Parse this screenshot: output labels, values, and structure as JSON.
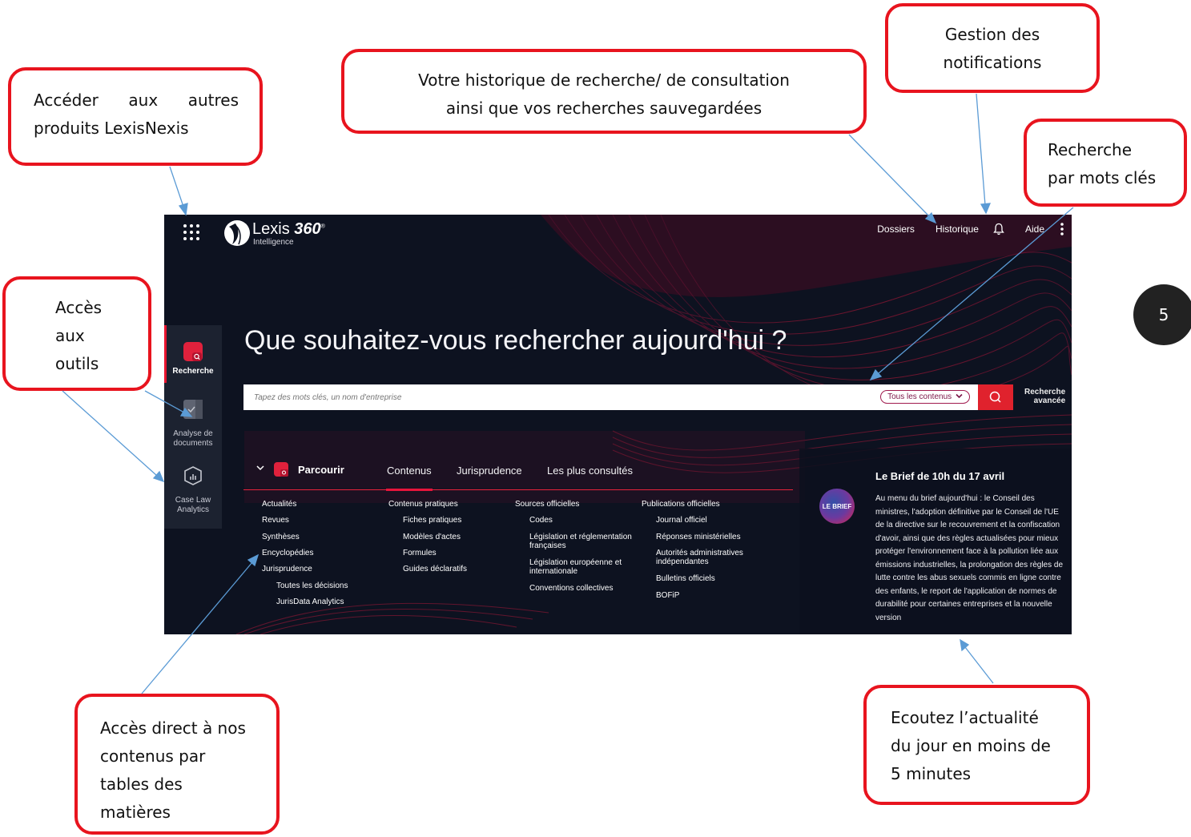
{
  "page_number": "5",
  "callouts": {
    "products": {
      "line1": "Accéder aux autres",
      "line2": "produits LexisNexis"
    },
    "history": {
      "line1": "Votre historique de recherche/ de consultation",
      "line2": "ainsi que vos recherches sauvegardées"
    },
    "notifications": {
      "line1": "Gestion des",
      "line2": "notifications"
    },
    "keyword": {
      "line1": "Recherche",
      "line2": "par mots clés"
    },
    "tools": {
      "line1": "Accès",
      "line2": "aux",
      "line3": "outils"
    },
    "toc": {
      "line1": "Accès direct à nos",
      "line2": "contenus par",
      "line3": "tables des",
      "line4": "matières"
    },
    "brief": {
      "line1": "Ecoutez l’actualité",
      "line2": "du jour en moins de",
      "line3": "5 minutes"
    }
  },
  "app": {
    "brand_name": "Lexis",
    "brand_version": "360",
    "brand_trademark": "®",
    "brand_sub": "Intelligence",
    "topnav": {
      "dossiers": "Dossiers",
      "historique": "Historique",
      "aide": "Aide"
    },
    "sidebar": {
      "recherche": "Recherche",
      "analyse_line1": "Analyse de",
      "analyse_line2": "documents",
      "caselaw_line1": "Case Law",
      "caselaw_line2": "Analytics"
    },
    "hero_title": "Que souhaitez-vous rechercher aujourd'hui ?",
    "search": {
      "placeholder": "Tapez des mots clés, un nom d'entreprise",
      "scope": "Tous les contenus",
      "advanced_line1": "Recherche",
      "advanced_line2": "avancée"
    },
    "browse": {
      "label": "Parcourir",
      "tabs": [
        "Contenus",
        "Jurisprudence",
        "Les plus consultés"
      ],
      "active_tab": "Contenus",
      "columns": [
        [
          "Actualités",
          "Revues",
          "Synthèses",
          "Encyclopédies",
          "Jurisprudence",
          "Toutes les décisions",
          "JurisData Analytics"
        ],
        [
          "Contenus pratiques",
          "Fiches pratiques",
          "Modèles d'actes",
          "Formules",
          "Guides déclaratifs"
        ],
        [
          "Sources officielles",
          "Codes",
          "Législation et réglementation françaises",
          "Législation européenne et internationale",
          "Conventions collectives"
        ],
        [
          "Publications officielles",
          "Journal officiel",
          "Réponses ministérielles",
          "Autorités administratives indépendantes",
          "Bulletins officiels",
          "BOFiP"
        ]
      ]
    },
    "brief": {
      "logo": "LE BRIEF",
      "title": "Le Brief de 10h du 17 avril",
      "text": "Au menu du brief aujourd'hui : le Conseil des ministres, l'adoption définitive par le Conseil de l'UE de la directive sur le recouvrement et la confiscation d'avoir, ainsi que des règles actualisées pour mieux protéger l'environnement face à la pollution liée aux émissions industrielles, la prolongation des règles de lutte contre les abus sexuels commis en ligne contre des enfants, le report de l'application de normes de durabilité pour certaines entreprises et la nouvelle version"
    }
  },
  "colors": {
    "accent": "#e8141e",
    "background": "#0d1220",
    "panel": "#1c2230",
    "arrow": "#5b9bd5"
  }
}
